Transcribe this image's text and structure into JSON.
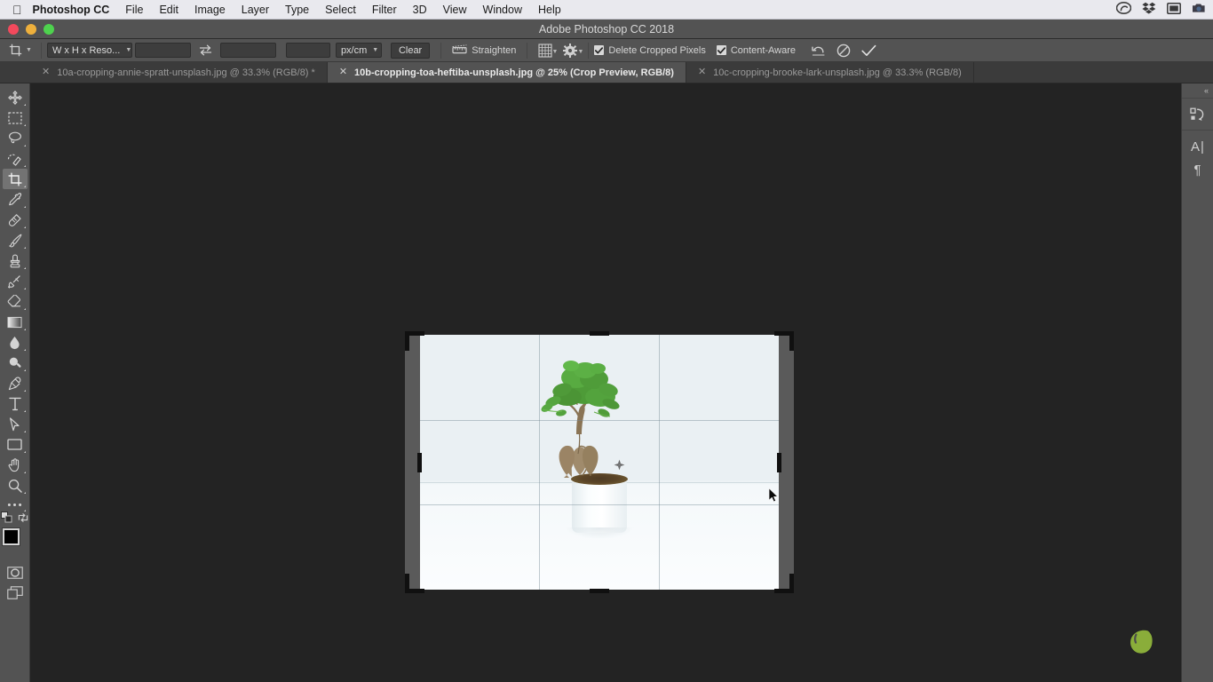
{
  "menubar": {
    "apple_icon": "apple-logo-icon",
    "app_name": "Photoshop CC",
    "items": [
      "File",
      "Edit",
      "Image",
      "Layer",
      "Type",
      "Select",
      "Filter",
      "3D",
      "View",
      "Window",
      "Help"
    ],
    "status_icons": [
      "creative-cloud-icon",
      "dropbox-icon",
      "display-icon",
      "camera-icon"
    ]
  },
  "titlebar": {
    "title": "Adobe Photoshop CC 2018",
    "traffic_lights": {
      "close_color": "#f2495c",
      "minimize_color": "#eeb03c",
      "zoom_color": "#4ed24e"
    }
  },
  "options_bar": {
    "tool_icon": "crop-tool-icon",
    "ratio_select": "W x H x Reso...",
    "width_value": "",
    "width_placeholder": "",
    "height_value": "",
    "height_placeholder": "",
    "resolution_value": "",
    "resolution_placeholder": "",
    "swap_icon": "swap-dimensions-icon",
    "unit_select": "px/cm",
    "clear_label": "Clear",
    "straighten_icon": "straighten-icon",
    "straighten_label": "Straighten",
    "overlay_icon": "grid-overlay-icon",
    "settings_icon": "gear-icon",
    "delete_cropped_label": "Delete Cropped Pixels",
    "delete_cropped_checked": true,
    "content_aware_label": "Content-Aware",
    "content_aware_checked": true,
    "reset_icon": "reset-icon",
    "cancel_icon": "cancel-icon",
    "commit_icon": "commit-checkmark-icon"
  },
  "tabs": [
    {
      "label": "10a-cropping-annie-spratt-unsplash.jpg @ 33.3% (RGB/8) *",
      "active": false,
      "close_icon": "close-icon"
    },
    {
      "label": "10b-cropping-toa-heftiba-unsplash.jpg @ 25% (Crop Preview, RGB/8)",
      "active": true,
      "close_icon": "close-icon"
    },
    {
      "label": "10c-cropping-brooke-lark-unsplash.jpg @ 33.3% (RGB/8)",
      "active": false,
      "close_icon": "close-icon"
    }
  ],
  "toolbar": {
    "tools": [
      {
        "name": "move-tool",
        "selected": false
      },
      {
        "name": "rectangular-marquee-tool",
        "selected": false
      },
      {
        "name": "lasso-tool",
        "selected": false
      },
      {
        "name": "quick-selection-tool",
        "selected": false
      },
      {
        "name": "crop-tool",
        "selected": true
      },
      {
        "name": "eyedropper-tool",
        "selected": false
      },
      {
        "name": "healing-brush-tool",
        "selected": false
      },
      {
        "name": "brush-tool",
        "selected": false
      },
      {
        "name": "clone-stamp-tool",
        "selected": false
      },
      {
        "name": "history-brush-tool",
        "selected": false
      },
      {
        "name": "eraser-tool",
        "selected": false
      },
      {
        "name": "gradient-tool",
        "selected": false
      },
      {
        "name": "blur-tool",
        "selected": false
      },
      {
        "name": "dodge-tool",
        "selected": false
      },
      {
        "name": "pen-tool",
        "selected": false
      },
      {
        "name": "type-tool",
        "selected": false
      },
      {
        "name": "path-selection-tool",
        "selected": false
      },
      {
        "name": "rectangle-tool",
        "selected": false
      },
      {
        "name": "hand-tool",
        "selected": false
      },
      {
        "name": "zoom-tool",
        "selected": false
      },
      {
        "name": "edit-toolbar-more",
        "selected": false
      }
    ],
    "foreground_color": "#000000",
    "background_color": "#3c3c3c",
    "quick_mask_icon": "quick-mask-icon",
    "screen_mode_icon": "screen-mode-icon"
  },
  "canvas": {
    "background_color": "#232323",
    "crop_shade_color": "#5a5a5a",
    "image_description": "bonsai plant in white pot on white background",
    "overlay_type": "rule-of-thirds",
    "center_marker": "crop-center-marker",
    "cursor": "arrow-cursor"
  },
  "right_panel": {
    "collapse_icon": "collapse-panels-icon",
    "items": [
      {
        "name": "history-panel-icon",
        "glyph": "history"
      },
      {
        "name": "character-panel-icon",
        "glyph": "A"
      },
      {
        "name": "paragraph-panel-icon",
        "glyph": "¶"
      }
    ]
  },
  "watermark": {
    "name": "leaf-logo",
    "color": "#8aad3a"
  }
}
